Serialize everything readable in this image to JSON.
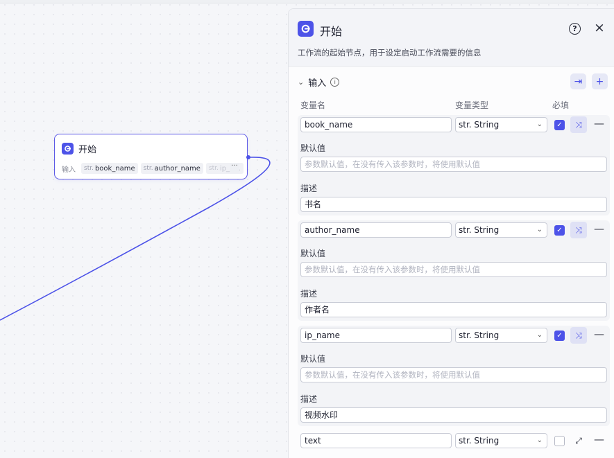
{
  "node": {
    "title": "开始",
    "input_label": "输入",
    "chips": [
      {
        "type": "str.",
        "name": "book_name"
      },
      {
        "type": "str.",
        "name": "author_name"
      },
      {
        "type": "str.",
        "name": "ip_n..."
      }
    ],
    "more": "···"
  },
  "panel": {
    "title": "开始",
    "help": "?",
    "close": "×",
    "description": "工作流的起始节点，用于设定启动工作流需要的信息",
    "section_title": "输入",
    "columns": {
      "name": "变量名",
      "type": "变量类型",
      "required": "必填"
    },
    "default_label": "默认值",
    "default_placeholder": "参数默认值，在没有传入该参数时，将使用默认值",
    "desc_label": "描述",
    "variables": [
      {
        "name": "book_name",
        "type": "str. String",
        "required": true,
        "description": "书名"
      },
      {
        "name": "author_name",
        "type": "str. String",
        "required": true,
        "description": "作者名"
      },
      {
        "name": "ip_name",
        "type": "str. String",
        "required": true,
        "description": "视频水印"
      },
      {
        "name": "text",
        "type": "str. String",
        "required": false
      }
    ]
  },
  "colors": {
    "accent": "#4d53e8",
    "edge": "#4d53e8"
  }
}
